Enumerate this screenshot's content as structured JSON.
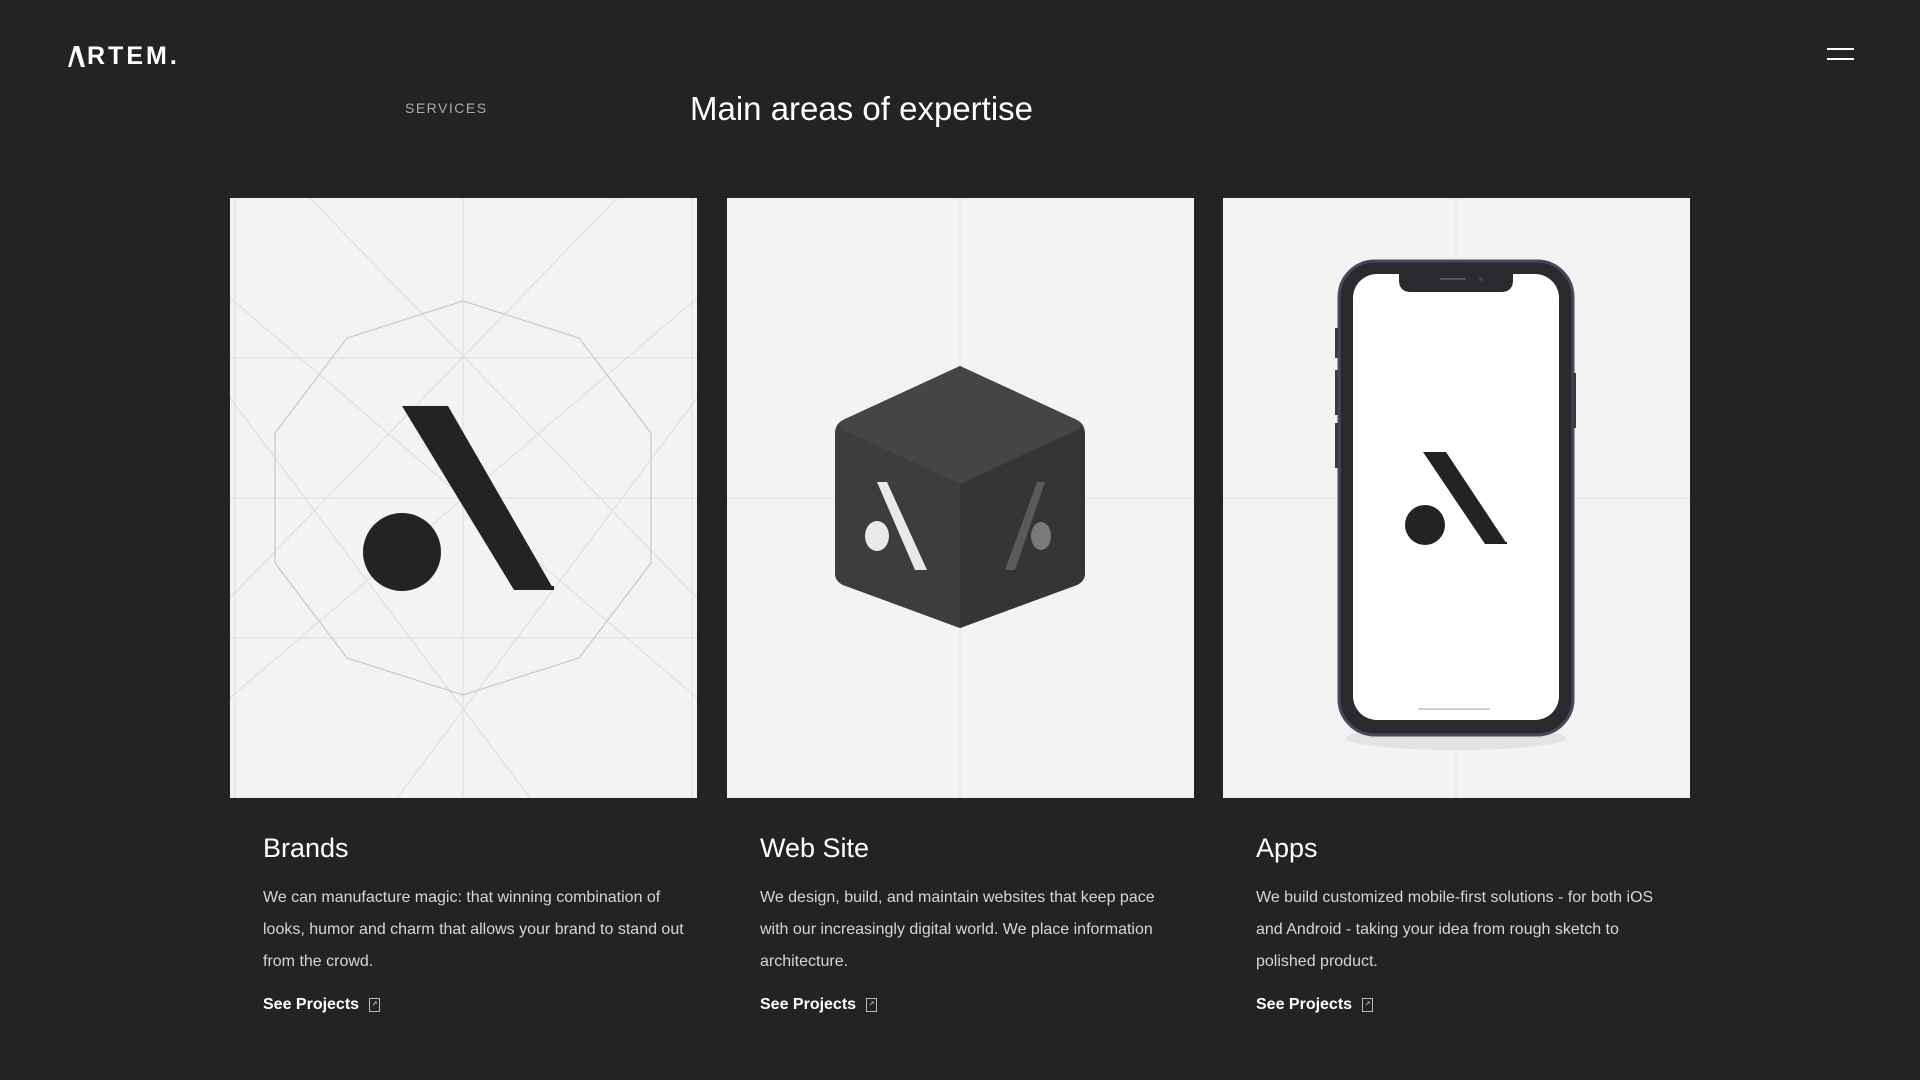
{
  "header": {
    "logo_text": "RTEM.",
    "menu_icon": "hamburger-icon"
  },
  "section": {
    "label": "SERVICES",
    "title": "Main areas of expertise"
  },
  "cards": [
    {
      "title": "Brands",
      "text": "We can manufacture magic: that winning combination of looks, humor and charm that allows your brand to stand out from the crowd.",
      "link_label": "See Projects",
      "link_icon": "arrow-icon",
      "image": "brand-logo-geometry"
    },
    {
      "title": "Web Site",
      "text": "We design, build, and maintain websites that keep pace with our increasingly digital world. We place information architecture.",
      "link_label": "See Projects",
      "link_icon": "arrow-icon",
      "image": "logo-cube"
    },
    {
      "title": "Apps",
      "text": "We build customized mobile-first solutions - for both iOS and Android - taking your idea from rough sketch to polished product.",
      "link_label": "See Projects",
      "link_icon": "arrow-icon",
      "image": "phone-mockup"
    }
  ],
  "colors": {
    "background": "#232323",
    "card_image_bg": "#f3f3f3",
    "text_primary": "#ffffff",
    "text_secondary": "#d6d6d6",
    "label": "#a9a9a9"
  }
}
